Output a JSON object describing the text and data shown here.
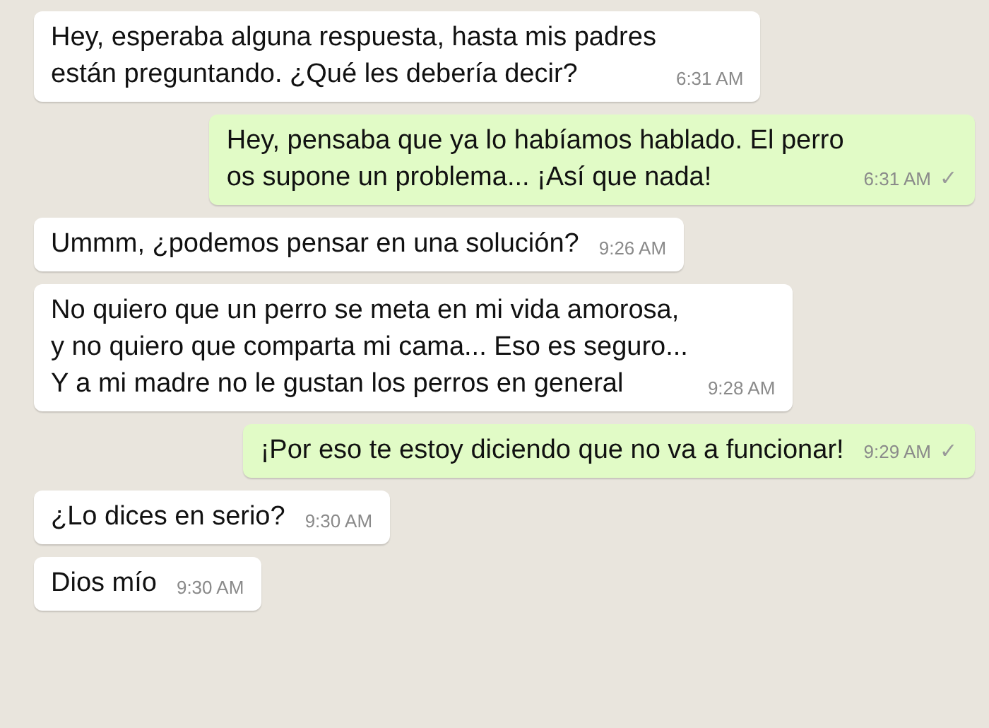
{
  "messages": [
    {
      "kind": "incoming",
      "text": "Hey, esperaba alguna respuesta, hasta mis padres\nestán preguntando. ¿Qué les debería decir?",
      "time": "6:31 AM"
    },
    {
      "kind": "outgoing",
      "text": "Hey, pensaba que ya lo habíamos hablado. El perro\nos supone un problema... ¡Así que nada!",
      "time": "6:31 AM",
      "tick": "✓"
    },
    {
      "kind": "incoming",
      "text": "Ummm, ¿podemos pensar en una solución?",
      "time": "9:26 AM"
    },
    {
      "kind": "incoming",
      "text": "No quiero que un perro se meta en mi vida amorosa,\ny no quiero que comparta mi cama... Eso es seguro...\nY a mi madre no le gustan los perros en general",
      "time": "9:28 AM"
    },
    {
      "kind": "outgoing",
      "text": "¡Por eso te estoy diciendo que no va a funcionar!",
      "time": "9:29 AM",
      "tick": "✓"
    },
    {
      "kind": "incoming",
      "text": "¿Lo dices en serio?",
      "time": "9:30 AM"
    },
    {
      "kind": "incoming",
      "text": "Dios mío",
      "time": "9:30 AM"
    }
  ]
}
